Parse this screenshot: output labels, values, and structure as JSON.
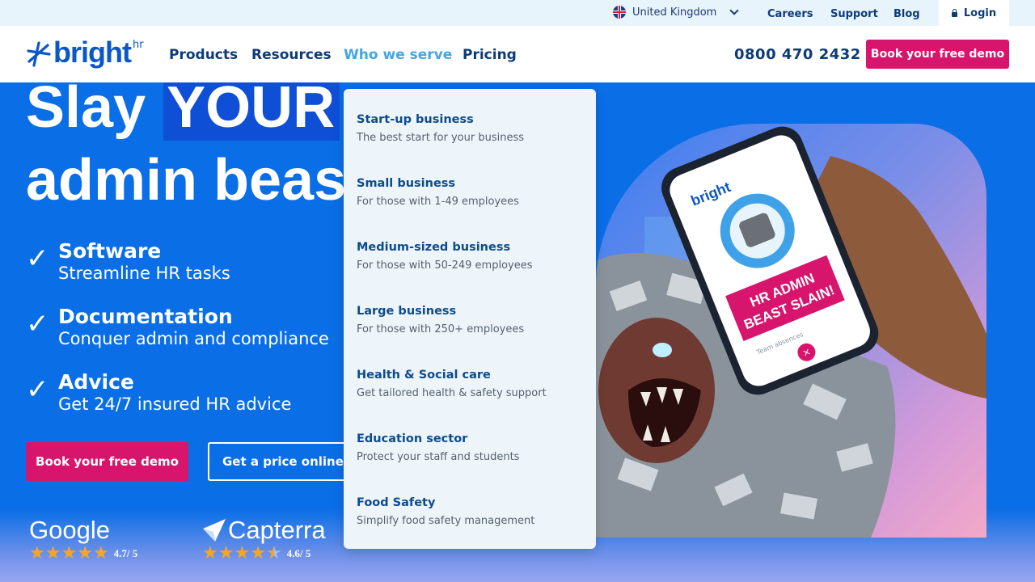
{
  "topbar": {
    "country": "United Kingdom",
    "links": [
      "Careers",
      "Support",
      "Blog"
    ],
    "login_label": "Login"
  },
  "nav": {
    "logo_text": "bright",
    "logo_sup": "hr",
    "items": [
      {
        "label": "Products"
      },
      {
        "label": "Resources"
      },
      {
        "label": "Who we serve",
        "active": true
      },
      {
        "label": "Pricing"
      }
    ],
    "phone": "0800 470 2432",
    "demo_label": "Book your free demo"
  },
  "hero": {
    "line1_a": "Slay",
    "line1_b": "YOUR",
    "line2": "admin beas",
    "features": [
      {
        "title": "Software",
        "subtitle": "Streamline HR tasks"
      },
      {
        "title": "Documentation",
        "subtitle": "Conquer admin and compliance"
      },
      {
        "title": "Advice",
        "subtitle": "Get 24/7 insured HR advice"
      }
    ],
    "cta_primary": "Book your free demo",
    "cta_secondary": "Get a price online",
    "check_glyph": "✓"
  },
  "ratings": [
    {
      "brand": "Google",
      "score": "4.7/ 5",
      "stars": 5
    },
    {
      "brand": "Capterra",
      "score": "4.6/ 5",
      "stars": 4.5
    }
  ],
  "phone_screen": {
    "banner_line1": "HR ADMIN",
    "banner_line2": "BEAST SLAIN!",
    "caption": "Team absences",
    "logo": "bright"
  },
  "dropdown": {
    "items": [
      {
        "title": "Start-up business",
        "desc": "The best start for your business"
      },
      {
        "title": "Small business",
        "desc": "For those with 1-49 employees"
      },
      {
        "title": "Medium-sized business",
        "desc": "For those with 50-249 employees"
      },
      {
        "title": "Large business",
        "desc": "For those with 250+ employees"
      },
      {
        "title": "Health & Social care",
        "desc": "Get tailored health & safety support"
      },
      {
        "title": "Education sector",
        "desc": "Protect your staff and students"
      },
      {
        "title": "Food Safety",
        "desc": "Simplify food safety management"
      }
    ]
  },
  "colors": {
    "hero_bg": "#0a6ee6",
    "brand_blue": "#0b57c8",
    "accent_pink": "#d8156c",
    "nav_text": "#0d3b7a",
    "active_nav": "#41a6e6"
  }
}
